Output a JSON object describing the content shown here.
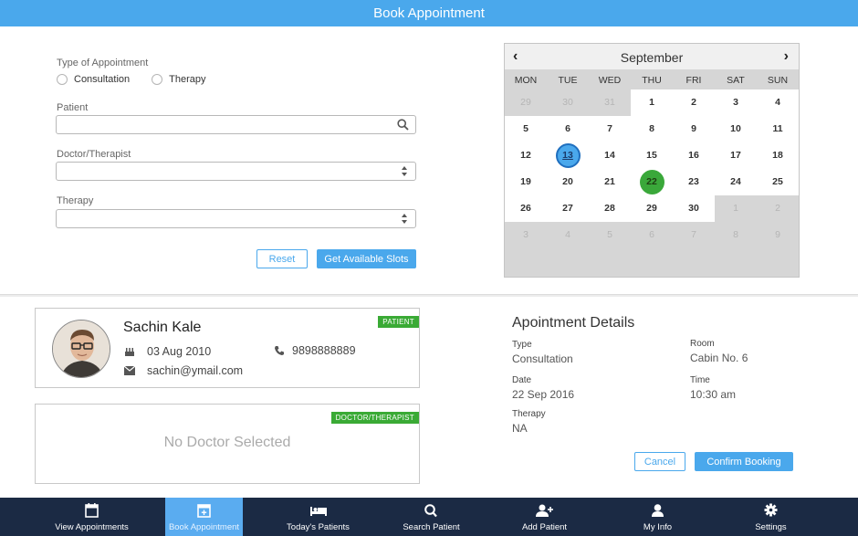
{
  "title": "Book Appointment",
  "form": {
    "type_label": "Type of Appointment",
    "type_options": [
      "Consultation",
      "Therapy"
    ],
    "patient_label": "Patient",
    "patient_value": "",
    "doctor_label": "Doctor/Therapist",
    "doctor_value": "",
    "therapy_label": "Therapy",
    "therapy_value": "",
    "reset_label": "Reset",
    "slots_label": "Get Available Slots"
  },
  "calendar": {
    "month": "September",
    "prev_icon": "chevron-left-icon",
    "next_icon": "chevron-right-icon",
    "weekdays": [
      "MON",
      "TUE",
      "WED",
      "THU",
      "FRI",
      "SAT",
      "SUN"
    ],
    "weeks": [
      [
        "29",
        "30",
        "31",
        "1",
        "2",
        "3",
        "4"
      ],
      [
        "5",
        "6",
        "7",
        "8",
        "9",
        "10",
        "11"
      ],
      [
        "12",
        "13",
        "14",
        "15",
        "16",
        "17",
        "18"
      ],
      [
        "19",
        "20",
        "21",
        "22",
        "23",
        "24",
        "25"
      ],
      [
        "26",
        "27",
        "28",
        "29",
        "30",
        "1",
        "2"
      ],
      [
        "3",
        "4",
        "5",
        "6",
        "7",
        "8",
        "9"
      ]
    ],
    "today": "13",
    "selected": "22",
    "accent_color": "#4aa8ec",
    "selected_color": "#3aa83a"
  },
  "patient_card": {
    "tag": "PATIENT",
    "name": "Sachin Kale",
    "dob": "03 Aug 2010",
    "phone": "9898888889",
    "email": "sachin@ymail.com",
    "icons": [
      "birthday-cake-icon",
      "phone-icon",
      "envelope-icon"
    ]
  },
  "doctor_card": {
    "tag": "DOCTOR/THERAPIST",
    "empty_text": "No Doctor Selected"
  },
  "details": {
    "title": "Apointment Details",
    "type_label": "Type",
    "type_value": "Consultation",
    "room_label": "Room",
    "room_value": "Cabin No. 6",
    "date_label": "Date",
    "date_value": "22 Sep 2016",
    "time_label": "Time",
    "time_value": "10:30 am",
    "therapy_label": "Therapy",
    "therapy_value": "NA",
    "cancel_label": "Cancel",
    "confirm_label": "Confirm Booking"
  },
  "tabs": [
    {
      "label": "View Appointments",
      "icon": "calendar-icon",
      "active": false
    },
    {
      "label": "Book Appointment",
      "icon": "calendar-plus-icon",
      "active": true
    },
    {
      "label": "Today's Patients",
      "icon": "bed-icon",
      "active": false
    },
    {
      "label": "Search Patient",
      "icon": "search-icon",
      "active": false
    },
    {
      "label": "Add Patient",
      "icon": "user-plus-icon",
      "active": false
    },
    {
      "label": "My Info",
      "icon": "user-icon",
      "active": false
    },
    {
      "label": "Settings",
      "icon": "gear-icon",
      "active": false
    }
  ],
  "colors": {
    "header": "#4aa8ec",
    "tabbar": "#1b2a44",
    "active_tab": "#5aacf0",
    "tag": "#3aaa35"
  }
}
